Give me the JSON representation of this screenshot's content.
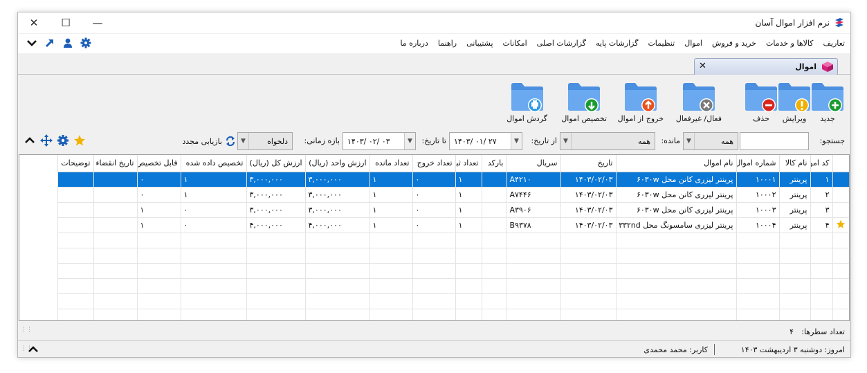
{
  "window": {
    "title": "نرم افزار اموال آسان",
    "minimize": "—",
    "maximize": "☐",
    "close": "✕"
  },
  "menu": [
    "تعاریف",
    "کالاها و خدمات",
    "خرید و فروش",
    "اموال",
    "تنظیمات",
    "گزارشات پایه",
    "گزارشات اصلی",
    "امکانات",
    "پشتیبانی",
    "راهنما",
    "درباره ما"
  ],
  "tab": {
    "label": "اموال",
    "close": "✕"
  },
  "toolbar": [
    {
      "key": "new",
      "label": "جدید",
      "badge_color": "#1a9b2f",
      "icon": "plus-icon"
    },
    {
      "key": "edit",
      "label": "ویرایش",
      "badge_color": "#f1b100",
      "icon": "exclamation-icon"
    },
    {
      "key": "delete",
      "label": "حذف",
      "badge_color": "#d9261c",
      "icon": "minus-icon"
    },
    {
      "key": "toggle",
      "label": "فعال/ غیرفعال",
      "badge_color": "#7a7a7a",
      "icon": "x-icon"
    },
    {
      "key": "exit",
      "label": "خروج از اموال",
      "badge_color": "#e8521e",
      "icon": "arrow-up-icon"
    },
    {
      "key": "assign",
      "label": "تخصیص اموال",
      "badge_color": "#1a9b2f",
      "icon": "arrow-down-icon"
    },
    {
      "key": "circulation",
      "label": "گردش اموال",
      "badge_color": "#2c9be6",
      "icon": "printer-icon"
    }
  ],
  "filters": {
    "search_label": "جستجو:",
    "search_value": "",
    "remaining_label": "مانده:",
    "remaining_value": "همه",
    "type_value": "همه",
    "from_label": "از تاریخ:",
    "from_value": "۱۴۰۳/ ۰۱/ ۲۷",
    "to_label": "تا تاریخ:",
    "to_value": "۱۴۰۳/ ۰۲/ ۰۳",
    "range_label": "بازه زمانی:",
    "range_value": "دلخواه",
    "reset_label": "بازیابی مجدد"
  },
  "grid": {
    "columns": [
      "کد اموال",
      "نام کالا",
      "شماره اموال",
      "نام اموال",
      "تاریخ",
      "سریال",
      "بارکد",
      "تعداد ثبت",
      "تعداد خروج",
      "تعداد مانده",
      "ارزش واحد (ریال)",
      "ارزش کل (ریال)",
      "تخصیص داده شده",
      "قابل تخصیص",
      "تاریخ انقضاء",
      "توضیحات"
    ],
    "rows": [
      {
        "code": "۱",
        "item": "پرینتر",
        "asset_no": "۱۰۰۰۱",
        "name": "پرینتر لیزری کانن محل ۶۰۳۰w",
        "date": "۱۴۰۳/۰۲/۰۳",
        "serial": "A۴۲۱۰",
        "barcode": "",
        "reg": "۱",
        "out": "۰",
        "rem": "۱",
        "unit": "۳,۰۰۰,۰۰۰",
        "total": "۳,۰۰۰,۰۰۰",
        "assigned": "۱",
        "assignable": "۰",
        "expire": "",
        "desc": "",
        "starred": false,
        "selected": true
      },
      {
        "code": "۲",
        "item": "پرینتر",
        "asset_no": "۱۰۰۰۲",
        "name": "پرینتر لیزری کانن محل ۶۰۳۰w",
        "date": "۱۴۰۳/۰۲/۰۳",
        "serial": "A۷۴۴۶",
        "barcode": "",
        "reg": "۱",
        "out": "۰",
        "rem": "۱",
        "unit": "۳,۰۰۰,۰۰۰",
        "total": "۳,۰۰۰,۰۰۰",
        "assigned": "۱",
        "assignable": "۰",
        "expire": "",
        "desc": "",
        "starred": false,
        "selected": false
      },
      {
        "code": "۳",
        "item": "پرینتر",
        "asset_no": "۱۰۰۰۳",
        "name": "پرینتر لیزری کانن محل ۶۰۳۰w",
        "date": "۱۴۰۳/۰۲/۰۳",
        "serial": "A۳۹۰۶",
        "barcode": "",
        "reg": "۱",
        "out": "۰",
        "rem": "۱",
        "unit": "۳,۰۰۰,۰۰۰",
        "total": "۳,۰۰۰,۰۰۰",
        "assigned": "۰",
        "assignable": "۱",
        "expire": "",
        "desc": "",
        "starred": false,
        "selected": false
      },
      {
        "code": "۴",
        "item": "پرینتر",
        "asset_no": "۱۰۰۰۴",
        "name": "پرینتر لیزری سامسونگ محل ۳۳۲nd",
        "date": "۱۴۰۳/۰۲/۰۳",
        "serial": "B۹۳۷۸",
        "barcode": "",
        "reg": "۱",
        "out": "۰",
        "rem": "۱",
        "unit": "۴,۰۰۰,۰۰۰",
        "total": "۴,۰۰۰,۰۰۰",
        "assigned": "۰",
        "assignable": "۱",
        "expire": "",
        "desc": "",
        "starred": true,
        "selected": false
      }
    ],
    "empty_rows": 6
  },
  "footer": {
    "count_label": "تعداد سطرها:",
    "count_value": "۴"
  },
  "status": {
    "today": "امروز: دوشنبه ۳ اردیبهشت ۱۴۰۳",
    "user": "کاربر: محمد محمدی"
  },
  "colors": {
    "selection": "#0a78d7",
    "folder": "#4a8fe0",
    "star": "#f0b400",
    "icon_blue": "#1c5fb8"
  }
}
